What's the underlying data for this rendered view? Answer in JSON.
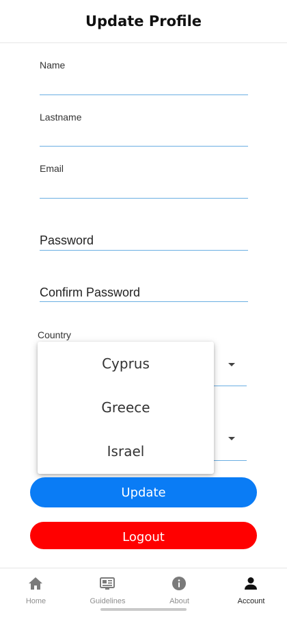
{
  "header": {
    "title": "Update Profile"
  },
  "form": {
    "name_label": "Name",
    "lastname_label": "Lastname",
    "email_label": "Email",
    "password_placeholder": "Password",
    "confirm_password_placeholder": "Confirm Password",
    "country_label": "Country"
  },
  "country_menu": {
    "options": [
      "Cyprus",
      "Greece",
      "Israel"
    ]
  },
  "buttons": {
    "update": "Update",
    "logout": "Logout"
  },
  "tabbar": {
    "tabs": [
      {
        "label": "Home",
        "icon": "home-icon"
      },
      {
        "label": "Guidelines",
        "icon": "guidelines-icon"
      },
      {
        "label": "About",
        "icon": "info-icon"
      },
      {
        "label": "Account",
        "icon": "account-icon"
      }
    ],
    "active": "Account"
  },
  "colors": {
    "accent": "#0a7cf5",
    "danger": "#ff0000",
    "underline": "#6aaee2"
  }
}
